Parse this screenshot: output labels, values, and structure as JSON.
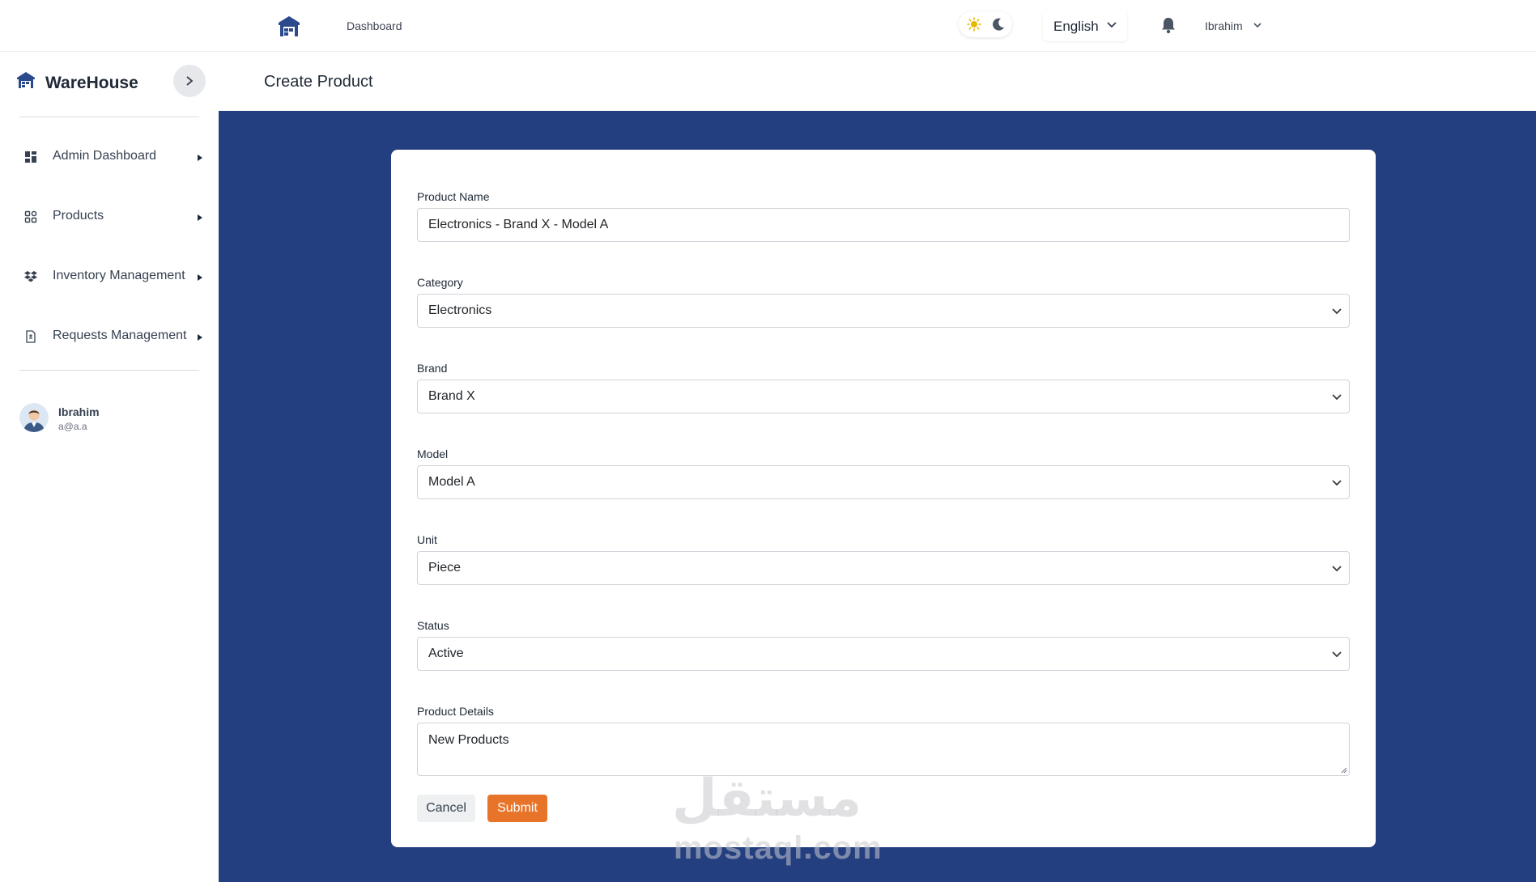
{
  "topbar": {
    "dashboard_link": "Dashboard",
    "language": "English",
    "user_name": "Ibrahim",
    "icons": [
      "warehouse-home-icon",
      "sun-icon",
      "moon-icon",
      "chevron-down-icon",
      "bell-icon"
    ]
  },
  "sidebar": {
    "brand": "WareHouse",
    "items": [
      {
        "label": "Admin Dashboard",
        "icon": "dashboard-grid-icon"
      },
      {
        "label": "Products",
        "icon": "products-grid-icon"
      },
      {
        "label": "Inventory Management",
        "icon": "dropbox-icon"
      },
      {
        "label": "Requests Management",
        "icon": "document-icon"
      }
    ],
    "profile": {
      "name": "Ibrahim",
      "email": "a@a.a"
    }
  },
  "page": {
    "title": "Create Product"
  },
  "form": {
    "product_name": {
      "label": "Product Name",
      "value": "Electronics - Brand X - Model A"
    },
    "category": {
      "label": "Category",
      "value": "Electronics"
    },
    "brand": {
      "label": "Brand",
      "value": "Brand X"
    },
    "model": {
      "label": "Model",
      "value": "Model A"
    },
    "unit": {
      "label": "Unit",
      "value": "Piece"
    },
    "status": {
      "label": "Status",
      "value": "Active"
    },
    "details": {
      "label": "Product Details",
      "value": "New Products"
    },
    "cancel_label": "Cancel",
    "submit_label": "Submit"
  },
  "watermark": {
    "arabic": "مستقل",
    "latin": "mostaql.com"
  },
  "colors": {
    "main_bg": "#243f80",
    "submit": "#e8742a",
    "brand_icon": "#2b4a8c"
  }
}
